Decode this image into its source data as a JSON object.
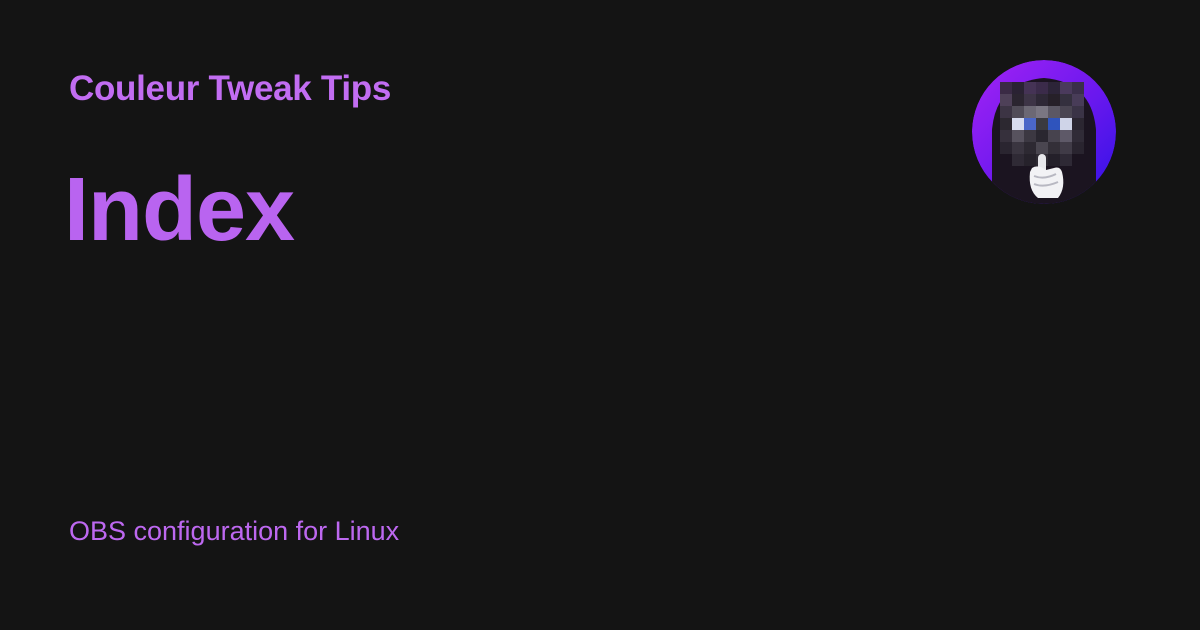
{
  "site": {
    "title": "Couleur Tweak Tips"
  },
  "page": {
    "title": "Index",
    "description": "OBS configuration for Linux"
  },
  "avatar": {
    "icon": "pixelated-hooded-figure-shush-avatar"
  },
  "colors": {
    "background": "#141414",
    "accent": "#c26df2",
    "avatar_gradient_start": "#9b1ff2",
    "avatar_gradient_end": "#3d12e8"
  }
}
